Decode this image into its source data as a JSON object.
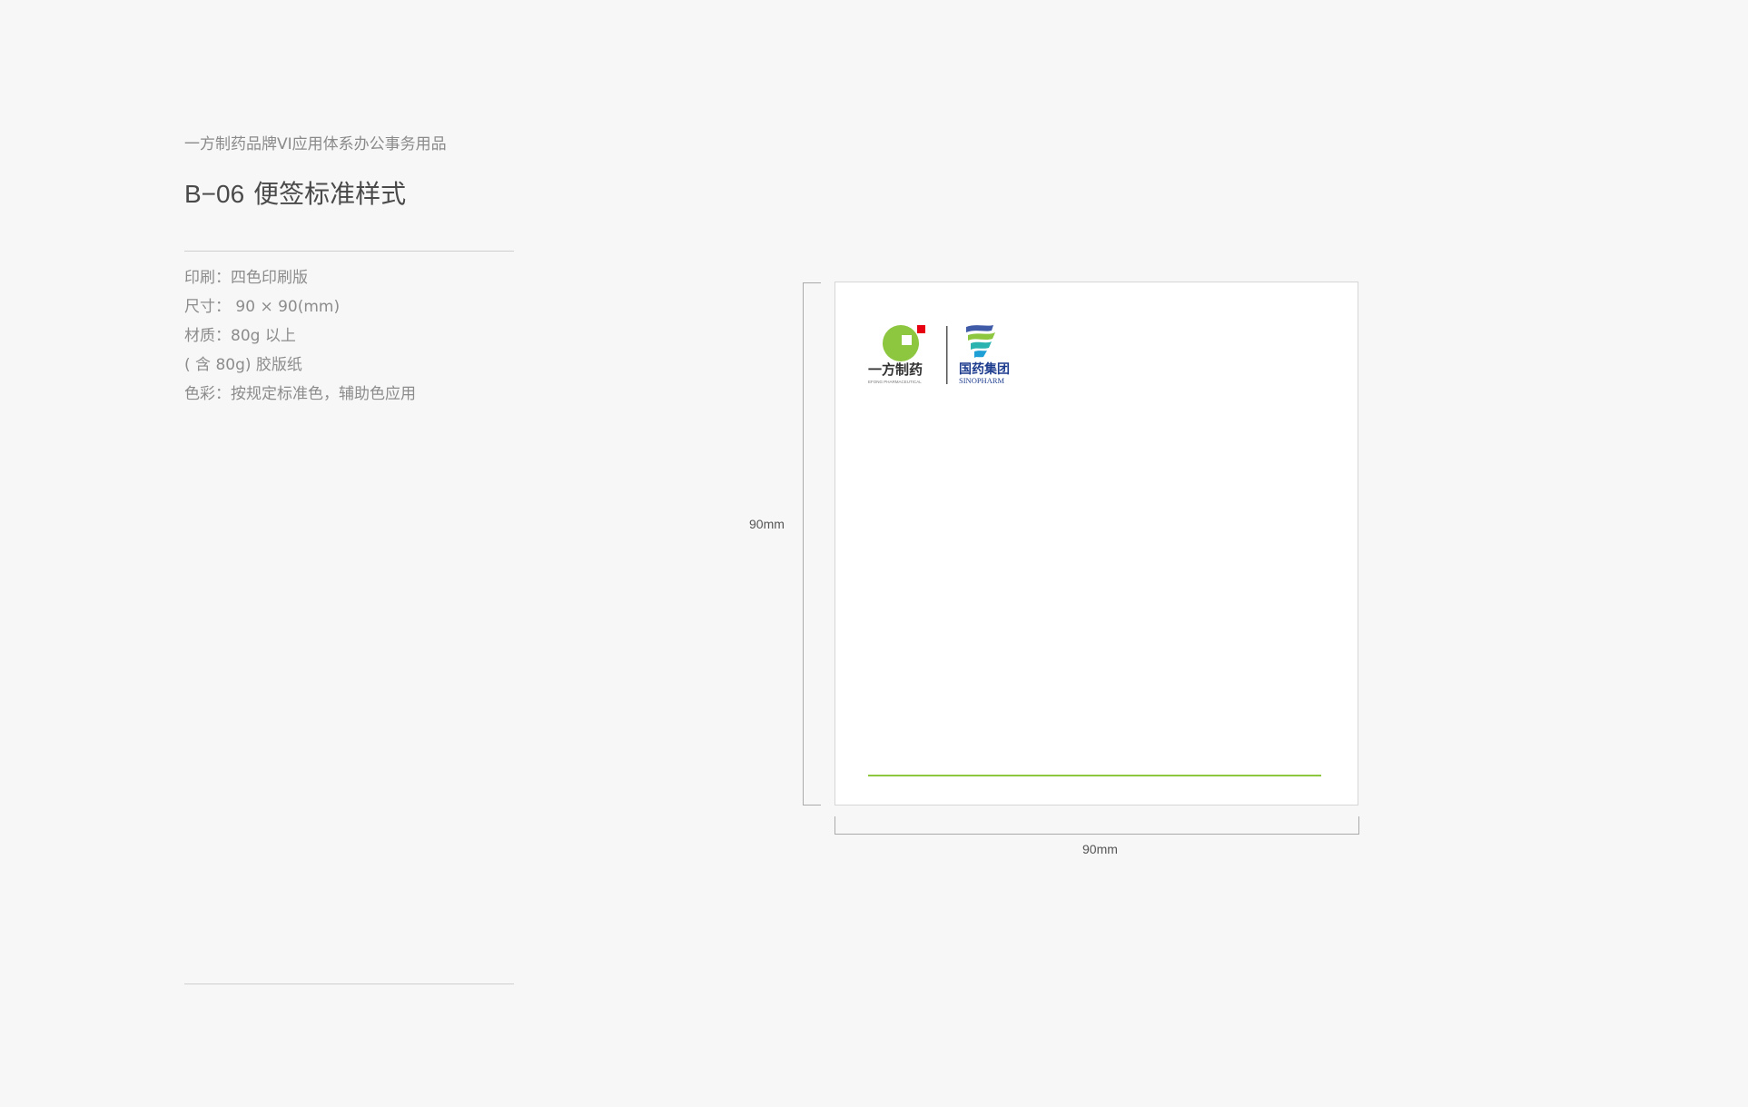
{
  "header": {
    "subtitle": "一方制药品牌VI应用体系办公事务用品",
    "code": "B−06",
    "title": "便签标准样式"
  },
  "specs": [
    "印刷：四色印刷版",
    "尺寸： 90 × 90(mm)",
    "材质：80g 以上",
    "( 含 80g) 胶版纸",
    "色彩：按规定标准色，辅助色应用"
  ],
  "dimensions": {
    "height_label": "90mm",
    "width_label": "90mm"
  },
  "logo": {
    "yifang_name": "一方制药",
    "yifang_sub": "EFONG PHARMACEUTICAL",
    "sinopharm_name": "国药集团",
    "sinopharm_sub": "SINOPHARM"
  },
  "colors": {
    "accent_green": "#8dc63f",
    "logo_red": "#e60012",
    "sinopharm_blue": "#1e3d8f"
  }
}
